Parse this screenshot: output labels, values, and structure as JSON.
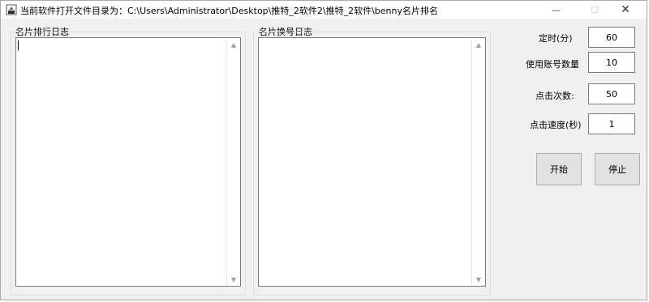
{
  "window": {
    "title": "当前软件打开文件目录为：C:\\Users\\Administrator\\Desktop\\推特_2软件2\\推特_2软件\\benny名片排名",
    "controls": {
      "minimize": "—",
      "maximize": "☐",
      "close": "✕"
    }
  },
  "left_panel": {
    "label": "名片排行日志",
    "value": ""
  },
  "right_panel": {
    "label": "名片换号日志",
    "value": ""
  },
  "settings": [
    {
      "label": "定时(分)",
      "value": "60"
    },
    {
      "label": "使用账号数量",
      "value": "10"
    },
    {
      "label": "点击次数:",
      "value": "50"
    },
    {
      "label": "点击速度(秒)",
      "value": "1"
    }
  ],
  "buttons": {
    "start": "开始",
    "stop": "停止"
  },
  "scroll_arrows": {
    "up": "▲",
    "down": "▼"
  }
}
